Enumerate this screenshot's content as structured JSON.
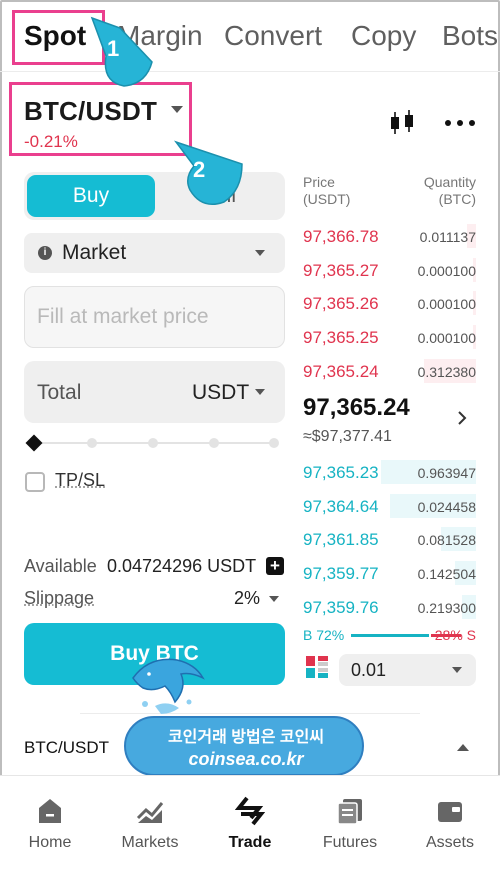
{
  "tabs": [
    {
      "label": "Spot",
      "active": true
    },
    {
      "label": "Margin",
      "active": false
    },
    {
      "label": "Convert",
      "active": false
    },
    {
      "label": "Copy",
      "active": false
    },
    {
      "label": "Bots",
      "active": false
    }
  ],
  "pair": {
    "symbol": "BTC/USDT",
    "change": "-0.21%"
  },
  "callouts": {
    "step1": "1",
    "step2": "2"
  },
  "order_form": {
    "side_buy": "Buy",
    "side_sell": "Sell",
    "order_type": "Market",
    "price_placeholder": "Fill at market price",
    "total_label": "Total",
    "total_unit": "USDT",
    "slider_percent": 0,
    "tpsl_label": "TP/SL",
    "available_label": "Available",
    "available_value": "0.04724296 USDT",
    "slippage_label": "Slippage",
    "slippage_value": "2%",
    "submit_label": "Buy BTC"
  },
  "order_book": {
    "price_header": "Price\n(USDT)",
    "qty_header": "Quantity\n(BTC)",
    "asks": [
      {
        "price": "97,366.78",
        "qty": "0.011137",
        "depth": 0.05
      },
      {
        "price": "97,365.27",
        "qty": "0.000100",
        "depth": 0.02
      },
      {
        "price": "97,365.26",
        "qty": "0.000100",
        "depth": 0.02
      },
      {
        "price": "97,365.25",
        "qty": "0.000100",
        "depth": 0.02
      },
      {
        "price": "97,365.24",
        "qty": "0.312380",
        "depth": 0.3
      }
    ],
    "last_price": "97,365.24",
    "last_price_usd": "≈$97,377.41",
    "bids": [
      {
        "price": "97,365.23",
        "qty": "0.963947",
        "depth": 0.55
      },
      {
        "price": "97,364.64",
        "qty": "0.024458",
        "depth": 0.5
      },
      {
        "price": "97,361.85",
        "qty": "0.081528",
        "depth": 0.2
      },
      {
        "price": "97,359.77",
        "qty": "0.142504",
        "depth": 0.12
      },
      {
        "price": "97,359.76",
        "qty": "0.219300",
        "depth": 0.08
      }
    ],
    "buy_ratio": "B 72%",
    "sell_ratio": "28% S",
    "depth_step": "0.01"
  },
  "position_bar": {
    "pair": "BTC/USDT"
  },
  "watermark": {
    "line1": "코인거래 방법은 코인씨",
    "line2": "coinsea.co.kr"
  },
  "bottom_nav": [
    {
      "label": "Home",
      "icon": "home-icon"
    },
    {
      "label": "Markets",
      "icon": "markets-icon"
    },
    {
      "label": "Trade",
      "icon": "trade-icon",
      "active": true
    },
    {
      "label": "Futures",
      "icon": "futures-icon"
    },
    {
      "label": "Assets",
      "icon": "assets-icon"
    }
  ],
  "colors": {
    "accent": "#15bcd3",
    "down": "#e0344e",
    "highlight": "#ea3f8e",
    "callout": "#26b4d6"
  }
}
